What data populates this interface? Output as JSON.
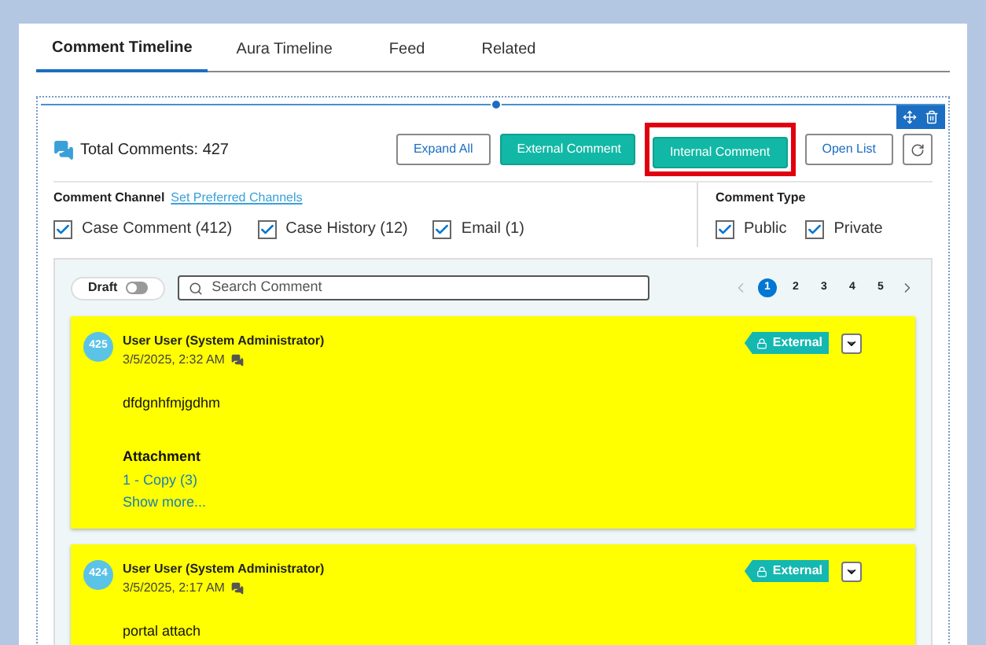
{
  "tabs": [
    {
      "label": "Comment Timeline",
      "selected": true
    },
    {
      "label": "Aura Timeline",
      "selected": false
    },
    {
      "label": "Feed",
      "selected": false
    },
    {
      "label": "Related",
      "selected": false
    }
  ],
  "total_comments": {
    "label": "Total Comments:",
    "count": "427"
  },
  "toolbar_buttons": [
    {
      "label": "Expand All",
      "kind": "outline",
      "highlighted": false
    },
    {
      "label": "External Comment",
      "kind": "filled",
      "highlighted": false
    },
    {
      "label": "Internal Comment",
      "kind": "filled",
      "highlighted": true
    },
    {
      "label": "Open List",
      "kind": "outline",
      "highlighted": false
    }
  ],
  "comment_channel": {
    "title": "Comment Channel",
    "link": "Set Preferred Channels",
    "options": [
      {
        "label": "Case Comment (412)",
        "checked": true
      },
      {
        "label": "Case History (12)",
        "checked": true
      },
      {
        "label": "Email (1)",
        "checked": true
      }
    ]
  },
  "comment_type": {
    "title": "Comment Type",
    "options": [
      {
        "label": "Public",
        "checked": true
      },
      {
        "label": "Private",
        "checked": true
      }
    ]
  },
  "draft": {
    "label": "Draft",
    "on": false
  },
  "search": {
    "placeholder": "Search Comment"
  },
  "pages": [
    {
      "label": "1",
      "selected": true
    },
    {
      "label": "2",
      "selected": false
    },
    {
      "label": "3",
      "selected": false
    },
    {
      "label": "4",
      "selected": false
    },
    {
      "label": "5",
      "selected": false
    }
  ],
  "comments": [
    {
      "number": "425",
      "author": "User User (System Administrator)",
      "date": "3/5/2025, 2:32 AM",
      "badge": "External",
      "body": "dfdgnhfmjgdhm",
      "attachment_title": "Attachment",
      "attachment": "1 - Copy (3)",
      "more": "Show more..."
    },
    {
      "number": "424",
      "author": "User User (System Administrator)",
      "date": "3/5/2025, 2:17 AM",
      "badge": "External",
      "body": "portal attach"
    }
  ]
}
